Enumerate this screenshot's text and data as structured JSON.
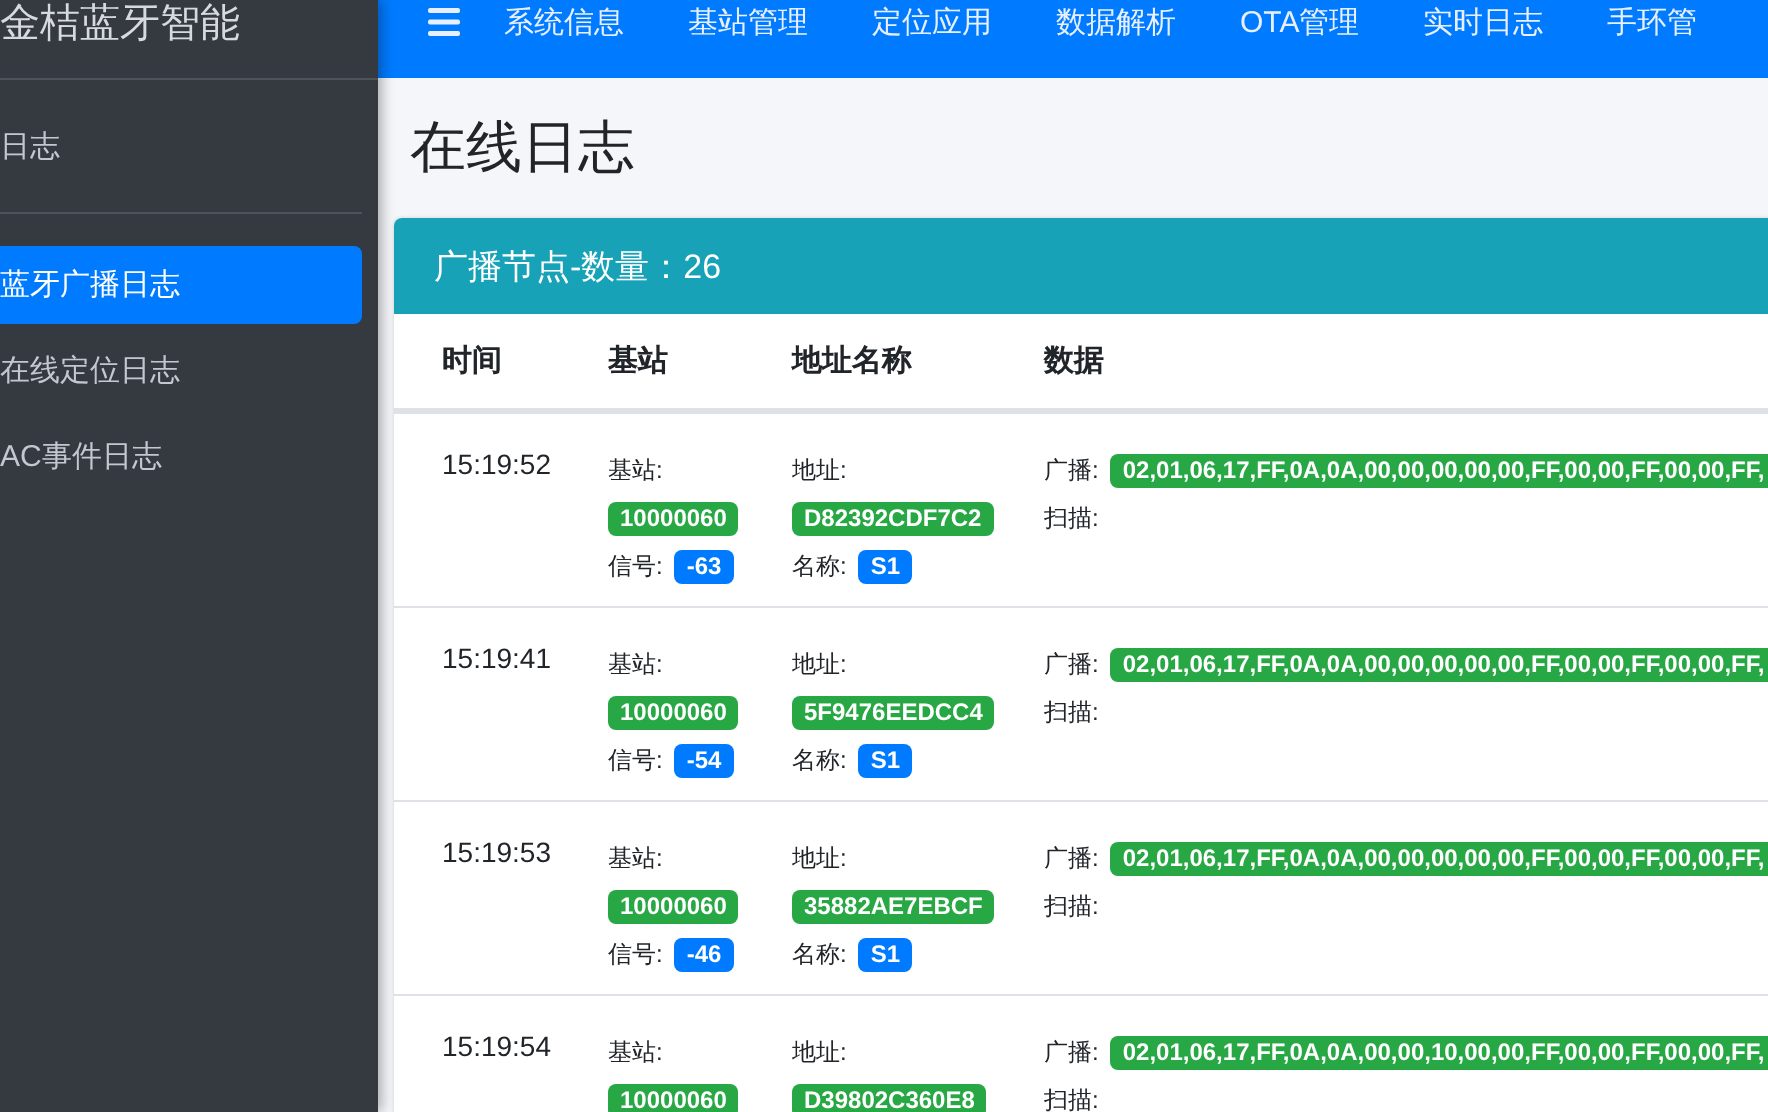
{
  "sidebar": {
    "brand": "金桔蓝牙智能",
    "group": "日志",
    "items": [
      {
        "label": "蓝牙广播日志",
        "selected": true
      },
      {
        "label": "在线定位日志",
        "selected": false
      },
      {
        "label": "AC事件日志",
        "selected": false
      }
    ]
  },
  "navbar": {
    "items": [
      "系统信息",
      "基站管理",
      "定位应用",
      "数据解析",
      "OTA管理",
      "实时日志",
      "手环管"
    ]
  },
  "page_title": "在线日志",
  "card": {
    "title": "广播节点-数量：26"
  },
  "table": {
    "columns": [
      "时间",
      "基站",
      "地址名称",
      "数据"
    ],
    "rows": [
      {
        "time": "15:19:52",
        "station_label": "基站:",
        "station": "10000060",
        "signal_label": "信号:",
        "signal": "-63",
        "address_label": "地址:",
        "address": "D82392CDF7C2",
        "name_label": "名称:",
        "name": "S1",
        "broadcast_label": "广播:",
        "broadcast": "02,01,06,17,FF,0A,0A,00,00,00,00,00,FF,00,00,FF,00,00,FF,",
        "scan_label": "扫描:"
      },
      {
        "time": "15:19:41",
        "station_label": "基站:",
        "station": "10000060",
        "signal_label": "信号:",
        "signal": "-54",
        "address_label": "地址:",
        "address": "5F9476EEDCC4",
        "name_label": "名称:",
        "name": "S1",
        "broadcast_label": "广播:",
        "broadcast": "02,01,06,17,FF,0A,0A,00,00,00,00,00,FF,00,00,FF,00,00,FF,",
        "scan_label": "扫描:"
      },
      {
        "time": "15:19:53",
        "station_label": "基站:",
        "station": "10000060",
        "signal_label": "信号:",
        "signal": "-46",
        "address_label": "地址:",
        "address": "35882AE7EBCF",
        "name_label": "名称:",
        "name": "S1",
        "broadcast_label": "广播:",
        "broadcast": "02,01,06,17,FF,0A,0A,00,00,00,00,00,FF,00,00,FF,00,00,FF,",
        "scan_label": "扫描:"
      },
      {
        "time": "15:19:54",
        "station_label": "基站:",
        "station": "10000060",
        "address_label": "地址:",
        "address": "D39802C360E8",
        "broadcast_label": "广播:",
        "broadcast": "02,01,06,17,FF,0A,0A,00,00,10,00,00,FF,00,00,FF,00,00,FF,",
        "scan_label": "扫描:"
      }
    ]
  }
}
